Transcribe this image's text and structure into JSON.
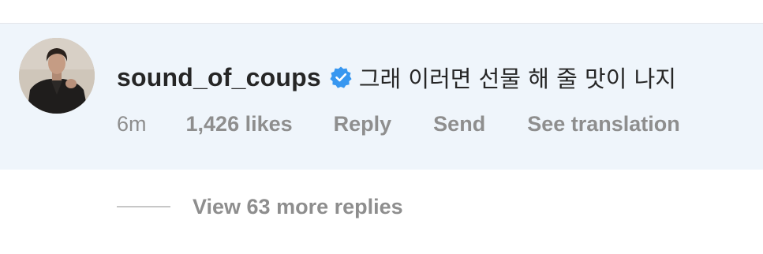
{
  "comment": {
    "username": "sound_of_coups",
    "verified_icon": "verified-badge-icon",
    "text": "그래 이러면 선물 해 줄 맛이 나지",
    "time": "6m",
    "likes": "1,426 likes",
    "reply_label": "Reply",
    "send_label": "Send",
    "translate_label": "See translation"
  },
  "replies": {
    "view_more_label": "View 63 more replies"
  },
  "colors": {
    "highlight_bg": "#eff5fb",
    "text_primary": "#262626",
    "text_secondary": "#8e8e8e",
    "verified_blue": "#3897f0"
  }
}
